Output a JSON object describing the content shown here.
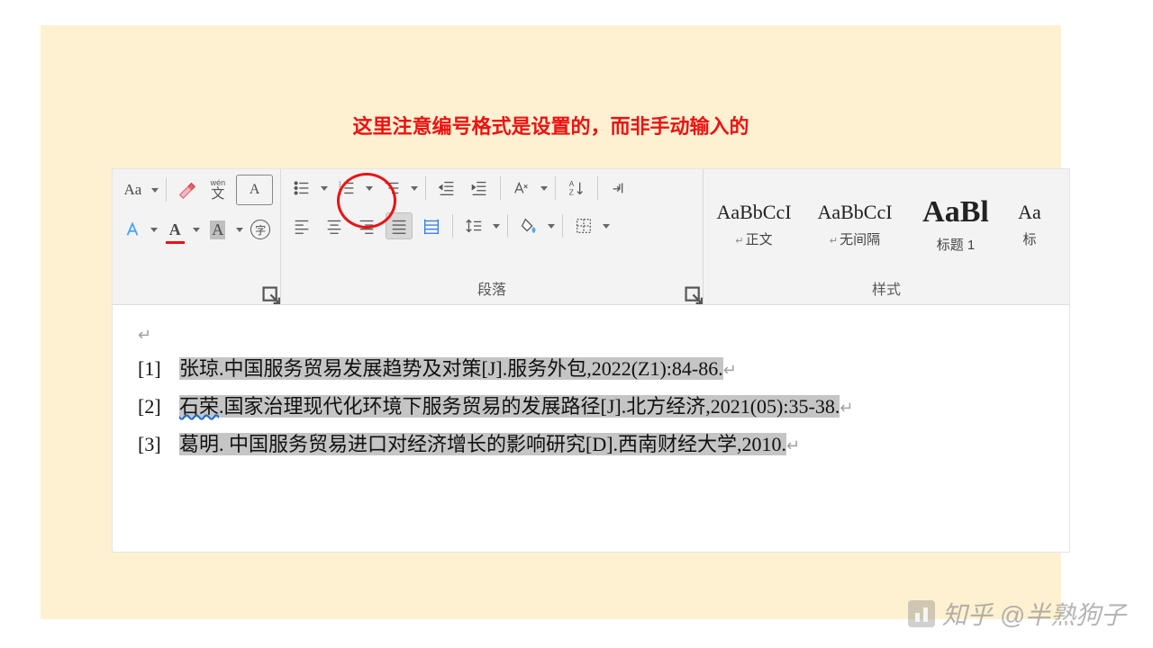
{
  "caption": "这里注意编号格式是设置的，而非手动输入的",
  "ribbon": {
    "font": {
      "change_case": "Aa",
      "pinyin_py": "wén",
      "pinyin_ch": "文",
      "char_border": "A",
      "font_color": "A",
      "highlight": "A",
      "enclose": "字"
    },
    "paragraph": {
      "label": "段落"
    },
    "styles": {
      "label": "样式",
      "items": [
        {
          "sample": "AaBbCcI",
          "name": "正文",
          "big": false,
          "ret": true
        },
        {
          "sample": "AaBbCcI",
          "name": "无间隔",
          "big": false,
          "ret": true
        },
        {
          "sample": "AaBl",
          "name": "标题 1",
          "big": true,
          "ret": false
        },
        {
          "sample": "Aa",
          "name": "标",
          "big": false,
          "ret": false
        }
      ]
    }
  },
  "document": {
    "refs": [
      {
        "num": "[1]",
        "text": "张琼.中国服务贸易发展趋势及对策[J].服务外包,2022(Z1):84-86."
      },
      {
        "num": "[2]",
        "prefix": "石荣",
        "text": ".国家治理现代化环境下服务贸易的发展路径[J].北方经济,2021(05):35-38."
      },
      {
        "num": "[3]",
        "text": "葛明. 中国服务贸易进口对经济增长的影响研究[D].西南财经大学,2010."
      }
    ]
  },
  "watermark": "知乎 @半熟狗子"
}
